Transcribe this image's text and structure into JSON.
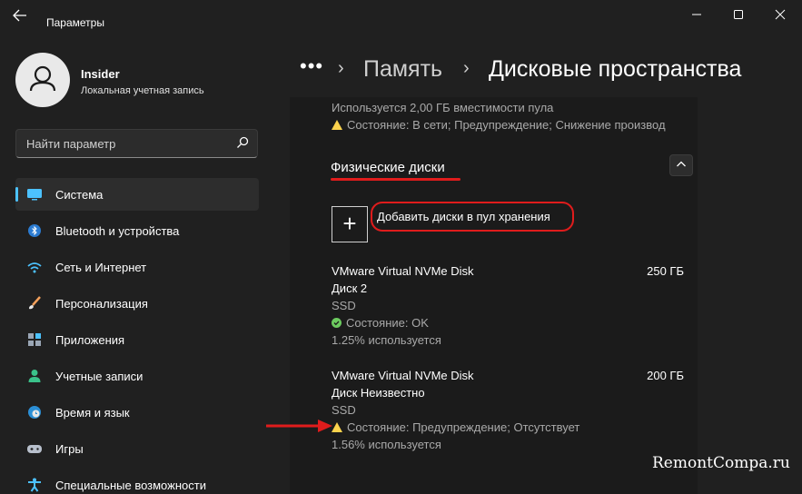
{
  "window": {
    "title": "Параметры",
    "minimize_icon": "minimize-icon",
    "maximize_icon": "maximize-icon",
    "close_icon": "close-icon"
  },
  "profile": {
    "name": "Insider",
    "account_type": "Локальная учетная запись"
  },
  "search": {
    "placeholder": "Найти параметр"
  },
  "sidebar": {
    "items": [
      {
        "label": "Система",
        "icon": "monitor-icon",
        "active": true
      },
      {
        "label": "Bluetooth и устройства",
        "icon": "bluetooth-icon",
        "active": false
      },
      {
        "label": "Сеть и Интернет",
        "icon": "wifi-icon",
        "active": false
      },
      {
        "label": "Персонализация",
        "icon": "brush-icon",
        "active": false
      },
      {
        "label": "Приложения",
        "icon": "apps-icon",
        "active": false
      },
      {
        "label": "Учетные записи",
        "icon": "person-icon",
        "active": false
      },
      {
        "label": "Время и язык",
        "icon": "clock-globe-icon",
        "active": false
      },
      {
        "label": "Игры",
        "icon": "gamepad-icon",
        "active": false
      },
      {
        "label": "Специальные возможности",
        "icon": "accessibility-icon",
        "active": false
      }
    ]
  },
  "breadcrumb": {
    "more": "•••",
    "separator": "›",
    "parent": "Память",
    "current": "Дисковые пространства"
  },
  "pool": {
    "capacity_text": "Используется 2,00 ГБ вместимости пула",
    "status_text": "Состояние: В сети; Предупреждение; Снижение производ"
  },
  "physical_disks": {
    "section_title": "Физические диски",
    "add_button_symbol": "+",
    "add_button_label": "Добавить диски в пул хранения",
    "collapse_symbol": "^",
    "disks": [
      {
        "model": "VMware Virtual NVMe Disk",
        "name": "Диск 2",
        "type": "SSD",
        "status": "Состояние: OK",
        "status_kind": "ok",
        "usage": "1.25% используется",
        "size": "250 ГБ"
      },
      {
        "model": "VMware Virtual NVMe Disk",
        "name": "Диск Неизвестно",
        "type": "SSD",
        "status": "Состояние: Предупреждение; Отсутствует",
        "status_kind": "warning",
        "usage": "1.56% используется",
        "size": "200 ГБ"
      }
    ]
  },
  "watermark": "RemontCompa.ru",
  "colors": {
    "accent": "#4cc2ff",
    "highlight": "#e01c1c",
    "warning": "#fcd34d",
    "ok": "#6ccb5f"
  }
}
